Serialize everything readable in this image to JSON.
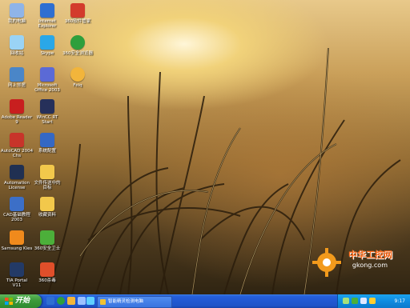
{
  "desktop_icons": [
    {
      "name": "my-computer-icon",
      "label": "我的电脑",
      "color": "#8fb4e8"
    },
    {
      "name": "ie-explorer-icon",
      "label": "Internet\nExplorer",
      "color": "#2f6fd1"
    },
    {
      "name": "360-software-icon",
      "label": "360软件管家",
      "color": "#d33b2c"
    },
    {
      "name": "recycle-bin-icon",
      "label": "回收站",
      "color": "#9ad3f5"
    },
    {
      "name": "qq-icon",
      "label": "Skype",
      "color": "#2aa7e8"
    },
    {
      "name": "360-browser-icon",
      "label": "360安全浏览器",
      "color": "#2e9f3c"
    },
    {
      "name": "network-icon",
      "label": "网上邻居",
      "color": "#4a86c8"
    },
    {
      "name": "media-player-icon",
      "label": "Microsoft\nOffice 2003",
      "color": "#5b6ad6"
    },
    {
      "name": "msn-icon",
      "label": "Feiq",
      "color": "#f2b53b"
    },
    {
      "name": "adobe-reader-icon",
      "label": "Adobe Reader\n9",
      "color": "#c81f1f"
    },
    {
      "name": "wincc-icon",
      "label": "WinCC RT\nStart",
      "color": "#26305a"
    },
    {
      "name": "autocad-icon",
      "label": "AutoCAD 2004\nChs",
      "color": "#c8342a"
    },
    {
      "name": "config-icon",
      "label": "系统配置",
      "color": "#3568c4"
    },
    {
      "name": "license-icon",
      "label": "Automation\nLicense",
      "color": "#203052"
    },
    {
      "name": "folder-icon",
      "label": "文件传送中的\n目标",
      "color": "#f2c84b"
    },
    {
      "name": "vnc-icon",
      "label": "CAD基础教程\n2003",
      "color": "#3c6fc7"
    },
    {
      "name": "folder2-icon",
      "label": "收藏资料",
      "color": "#f2c84b"
    },
    {
      "name": "samsung-icon",
      "label": "Samsung Kies",
      "color": "#f08a1c"
    },
    {
      "name": "360-safe-icon",
      "label": "360安全卫士",
      "color": "#4caf3a"
    },
    {
      "name": "tia-portal-icon",
      "label": "TIA Portal\nV11",
      "color": "#233a66"
    },
    {
      "name": "360-antivirus-icon",
      "label": "360杀毒",
      "color": "#e04f2a"
    }
  ],
  "watermark": {
    "title": "中华工控网",
    "url": "gkong.com"
  },
  "taskbar": {
    "start_label": "开始",
    "task_label": "智能精灵检测电脑",
    "clock": "9:17"
  }
}
